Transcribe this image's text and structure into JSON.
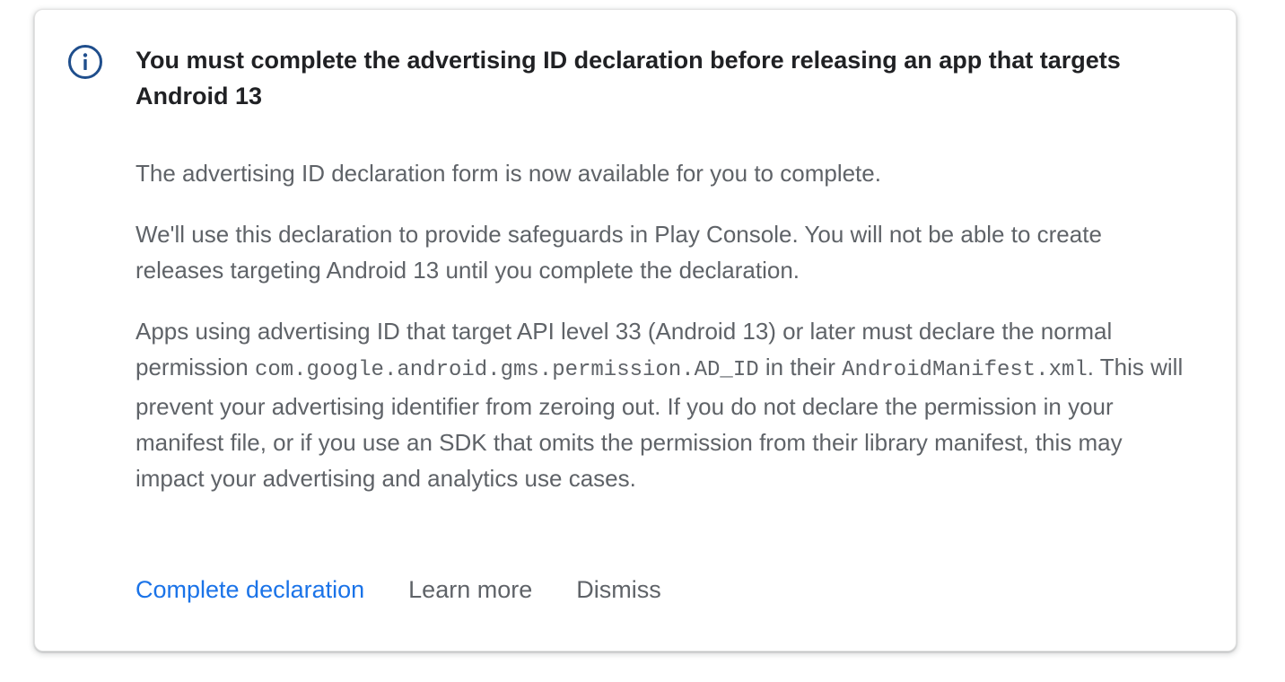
{
  "banner": {
    "icon": "info-icon",
    "accent_color": "#1a73e8",
    "icon_color": "#1f4e8c",
    "title": "You must complete the advertising ID declaration before releasing an app that targets Android 13",
    "paragraph_1": "The advertising ID declaration form is now available for you to complete.",
    "paragraph_2": "We'll use this declaration to provide safeguards in Play Console. You will not be able to create releases targeting Android 13 until you complete the declaration.",
    "paragraph_3": {
      "part_1": "Apps using advertising ID that target API level 33 (Android 13) or later must declare the normal permission ",
      "code_1": "com.google.android.gms.permission.AD_ID",
      "part_2": " in their ",
      "code_2": "AndroidManifest.xml",
      "part_3": ". This will prevent your advertising identifier from zeroing out. If you do not declare the permission in your manifest file, or if you use an SDK that omits the permission from their library manifest, this may impact your advertising and analytics use cases."
    },
    "actions": {
      "complete_label": "Complete declaration",
      "learn_more_label": "Learn more",
      "dismiss_label": "Dismiss"
    }
  }
}
